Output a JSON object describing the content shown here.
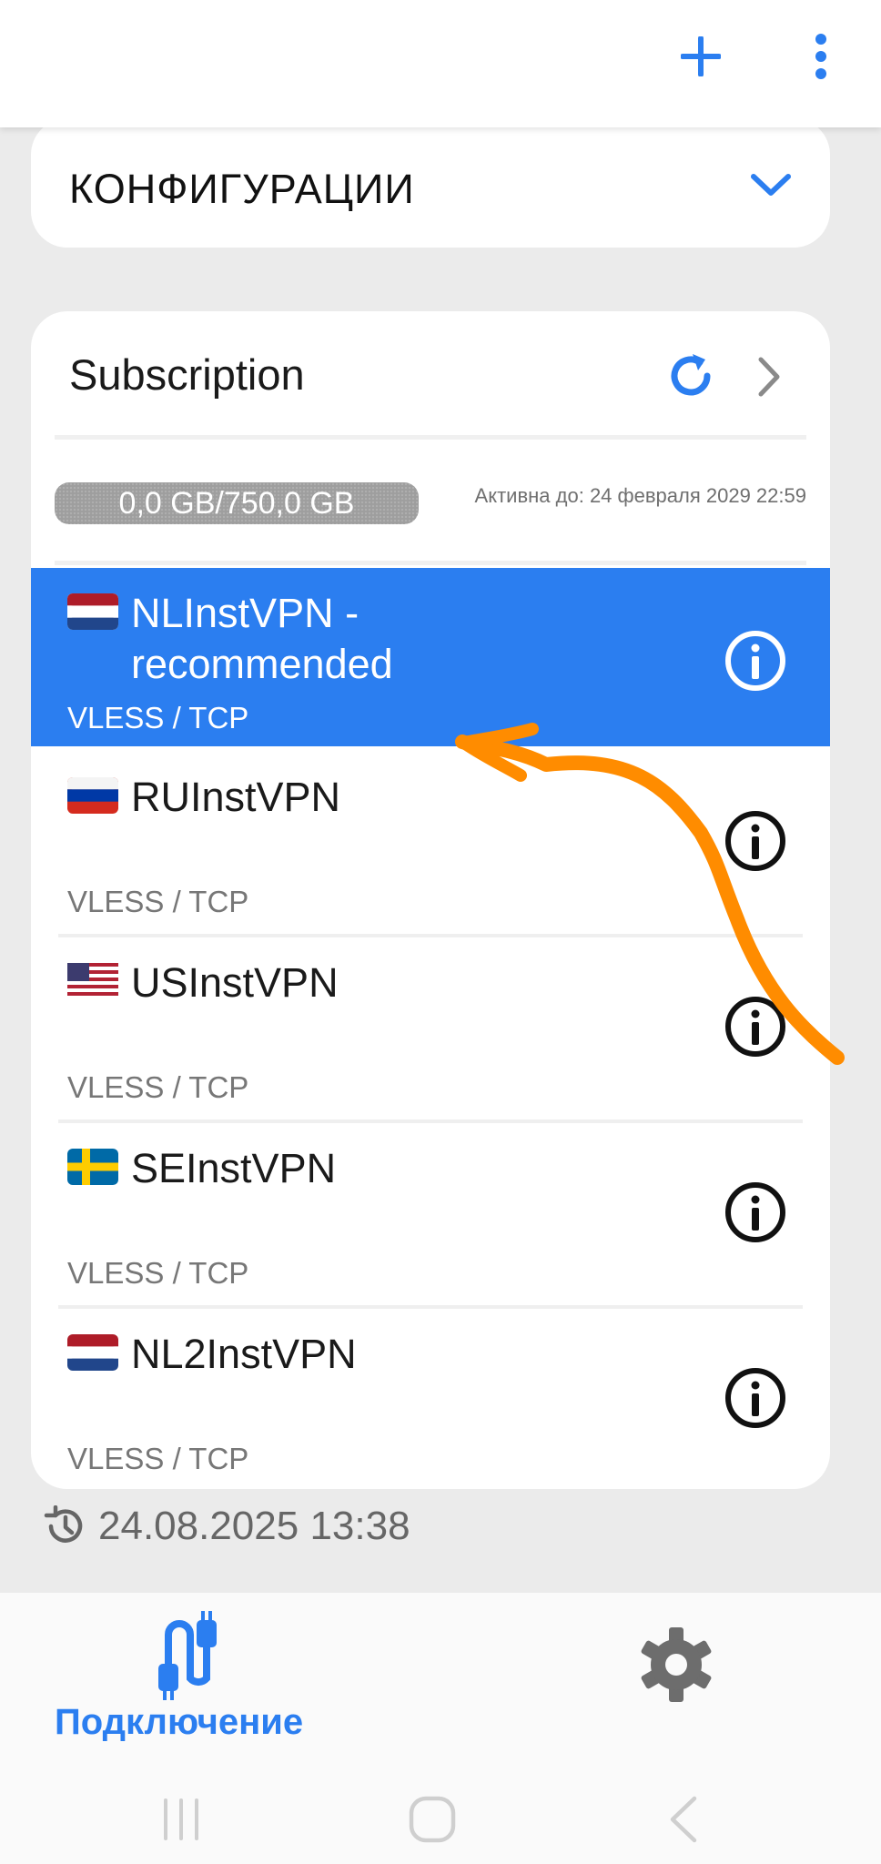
{
  "colors": {
    "accent": "#2b7ef0",
    "background": "#ebebeb",
    "card": "#ffffff",
    "annotation": "#ff8c00"
  },
  "topbar": {
    "add_icon": "plus-icon",
    "more_icon": "more-vertical-icon"
  },
  "config": {
    "title": "КОНФИГУРАЦИИ",
    "icon": "chevron-down-icon"
  },
  "subscription": {
    "title": "Subscription",
    "usage": "0,0 GB/750,0 GB",
    "active_until": "Активна до: 24 февраля 2029 22:59",
    "servers": [
      {
        "flag": "NL",
        "name": "NLInstVPN - recommended",
        "protocol": "VLESS / TCP",
        "selected": true
      },
      {
        "flag": "RU",
        "name": "RUInstVPN",
        "protocol": "VLESS / TCP",
        "selected": false
      },
      {
        "flag": "US",
        "name": "USInstVPN",
        "protocol": "VLESS / TCP",
        "selected": false
      },
      {
        "flag": "SE",
        "name": "SEInstVPN",
        "protocol": "VLESS / TCP",
        "selected": false
      },
      {
        "flag": "NL",
        "name": "NL2InstVPN",
        "protocol": "VLESS / TCP",
        "selected": false
      }
    ]
  },
  "last_updated": "24.08.2025 13:38",
  "bottom_nav": {
    "connect_label": "Подключение",
    "connect_icon": "cable-icon",
    "settings_icon": "gear-icon"
  }
}
